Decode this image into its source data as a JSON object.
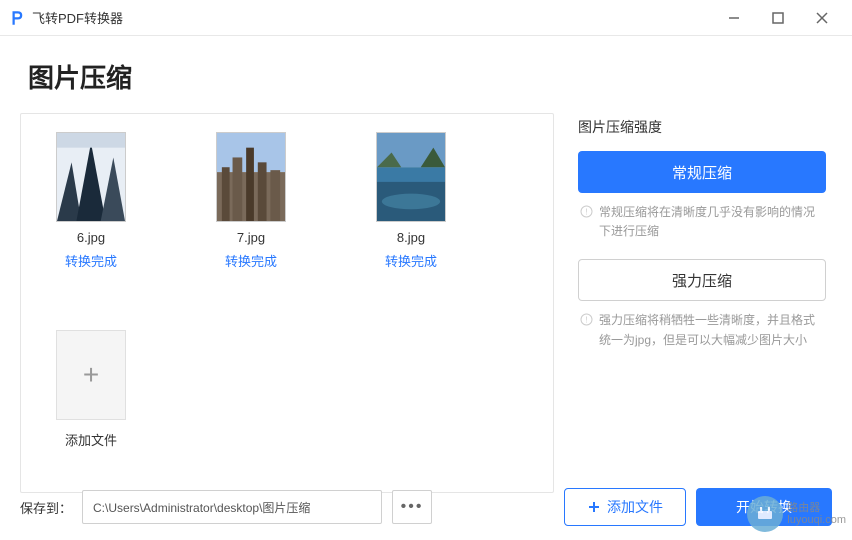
{
  "app": {
    "title": "飞转PDF转换器"
  },
  "page": {
    "title": "图片压缩"
  },
  "files": [
    {
      "name": "6.jpg",
      "status": "转换完成"
    },
    {
      "name": "7.jpg",
      "status": "转换完成"
    },
    {
      "name": "8.jpg",
      "status": "转换完成"
    }
  ],
  "addTile": {
    "label": "添加文件"
  },
  "compression": {
    "label": "图片压缩强度",
    "normal": "常规压缩",
    "normalHint": "常规压缩将在清晰度几乎没有影响的情况下进行压缩",
    "strong": "强力压缩",
    "strongHint": "强力压缩将稍牺牲一些清晰度，并且格式统一为jpg，但是可以大幅减少图片大小"
  },
  "footer": {
    "saveLabel": "保存到：",
    "path": "C:\\Users\\Administrator\\desktop\\图片压缩",
    "more": "•••",
    "addFile": "添加文件",
    "start": "开始转换"
  },
  "watermark": {
    "brand": "路由器",
    "domain": "luyouqi.com"
  }
}
